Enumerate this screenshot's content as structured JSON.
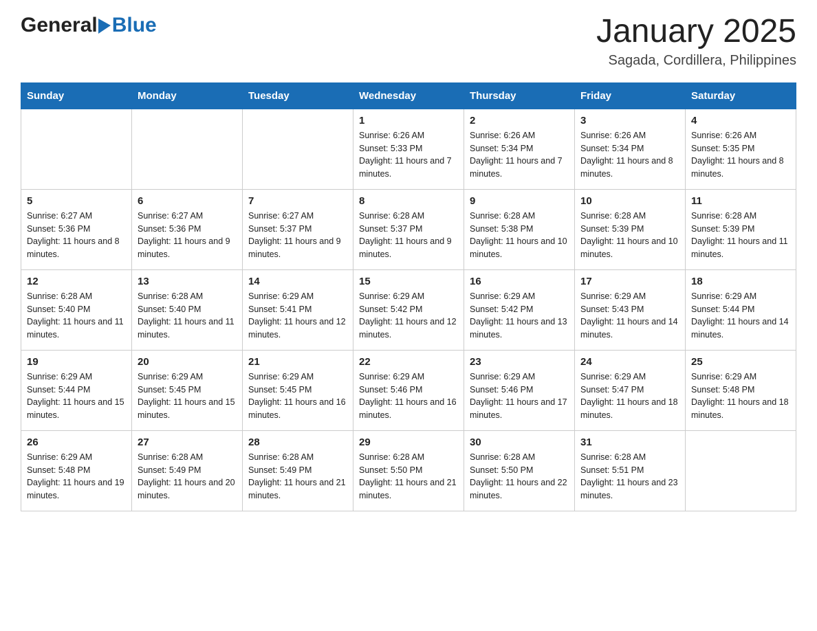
{
  "logo": {
    "text_general": "General",
    "text_blue": "Blue"
  },
  "header": {
    "month_year": "January 2025",
    "location": "Sagada, Cordillera, Philippines"
  },
  "days_of_week": [
    "Sunday",
    "Monday",
    "Tuesday",
    "Wednesday",
    "Thursday",
    "Friday",
    "Saturday"
  ],
  "weeks": [
    [
      {
        "day": "",
        "info": ""
      },
      {
        "day": "",
        "info": ""
      },
      {
        "day": "",
        "info": ""
      },
      {
        "day": "1",
        "info": "Sunrise: 6:26 AM\nSunset: 5:33 PM\nDaylight: 11 hours and 7 minutes."
      },
      {
        "day": "2",
        "info": "Sunrise: 6:26 AM\nSunset: 5:34 PM\nDaylight: 11 hours and 7 minutes."
      },
      {
        "day": "3",
        "info": "Sunrise: 6:26 AM\nSunset: 5:34 PM\nDaylight: 11 hours and 8 minutes."
      },
      {
        "day": "4",
        "info": "Sunrise: 6:26 AM\nSunset: 5:35 PM\nDaylight: 11 hours and 8 minutes."
      }
    ],
    [
      {
        "day": "5",
        "info": "Sunrise: 6:27 AM\nSunset: 5:36 PM\nDaylight: 11 hours and 8 minutes."
      },
      {
        "day": "6",
        "info": "Sunrise: 6:27 AM\nSunset: 5:36 PM\nDaylight: 11 hours and 9 minutes."
      },
      {
        "day": "7",
        "info": "Sunrise: 6:27 AM\nSunset: 5:37 PM\nDaylight: 11 hours and 9 minutes."
      },
      {
        "day": "8",
        "info": "Sunrise: 6:28 AM\nSunset: 5:37 PM\nDaylight: 11 hours and 9 minutes."
      },
      {
        "day": "9",
        "info": "Sunrise: 6:28 AM\nSunset: 5:38 PM\nDaylight: 11 hours and 10 minutes."
      },
      {
        "day": "10",
        "info": "Sunrise: 6:28 AM\nSunset: 5:39 PM\nDaylight: 11 hours and 10 minutes."
      },
      {
        "day": "11",
        "info": "Sunrise: 6:28 AM\nSunset: 5:39 PM\nDaylight: 11 hours and 11 minutes."
      }
    ],
    [
      {
        "day": "12",
        "info": "Sunrise: 6:28 AM\nSunset: 5:40 PM\nDaylight: 11 hours and 11 minutes."
      },
      {
        "day": "13",
        "info": "Sunrise: 6:28 AM\nSunset: 5:40 PM\nDaylight: 11 hours and 11 minutes."
      },
      {
        "day": "14",
        "info": "Sunrise: 6:29 AM\nSunset: 5:41 PM\nDaylight: 11 hours and 12 minutes."
      },
      {
        "day": "15",
        "info": "Sunrise: 6:29 AM\nSunset: 5:42 PM\nDaylight: 11 hours and 12 minutes."
      },
      {
        "day": "16",
        "info": "Sunrise: 6:29 AM\nSunset: 5:42 PM\nDaylight: 11 hours and 13 minutes."
      },
      {
        "day": "17",
        "info": "Sunrise: 6:29 AM\nSunset: 5:43 PM\nDaylight: 11 hours and 14 minutes."
      },
      {
        "day": "18",
        "info": "Sunrise: 6:29 AM\nSunset: 5:44 PM\nDaylight: 11 hours and 14 minutes."
      }
    ],
    [
      {
        "day": "19",
        "info": "Sunrise: 6:29 AM\nSunset: 5:44 PM\nDaylight: 11 hours and 15 minutes."
      },
      {
        "day": "20",
        "info": "Sunrise: 6:29 AM\nSunset: 5:45 PM\nDaylight: 11 hours and 15 minutes."
      },
      {
        "day": "21",
        "info": "Sunrise: 6:29 AM\nSunset: 5:45 PM\nDaylight: 11 hours and 16 minutes."
      },
      {
        "day": "22",
        "info": "Sunrise: 6:29 AM\nSunset: 5:46 PM\nDaylight: 11 hours and 16 minutes."
      },
      {
        "day": "23",
        "info": "Sunrise: 6:29 AM\nSunset: 5:46 PM\nDaylight: 11 hours and 17 minutes."
      },
      {
        "day": "24",
        "info": "Sunrise: 6:29 AM\nSunset: 5:47 PM\nDaylight: 11 hours and 18 minutes."
      },
      {
        "day": "25",
        "info": "Sunrise: 6:29 AM\nSunset: 5:48 PM\nDaylight: 11 hours and 18 minutes."
      }
    ],
    [
      {
        "day": "26",
        "info": "Sunrise: 6:29 AM\nSunset: 5:48 PM\nDaylight: 11 hours and 19 minutes."
      },
      {
        "day": "27",
        "info": "Sunrise: 6:28 AM\nSunset: 5:49 PM\nDaylight: 11 hours and 20 minutes."
      },
      {
        "day": "28",
        "info": "Sunrise: 6:28 AM\nSunset: 5:49 PM\nDaylight: 11 hours and 21 minutes."
      },
      {
        "day": "29",
        "info": "Sunrise: 6:28 AM\nSunset: 5:50 PM\nDaylight: 11 hours and 21 minutes."
      },
      {
        "day": "30",
        "info": "Sunrise: 6:28 AM\nSunset: 5:50 PM\nDaylight: 11 hours and 22 minutes."
      },
      {
        "day": "31",
        "info": "Sunrise: 6:28 AM\nSunset: 5:51 PM\nDaylight: 11 hours and 23 minutes."
      },
      {
        "day": "",
        "info": ""
      }
    ]
  ]
}
